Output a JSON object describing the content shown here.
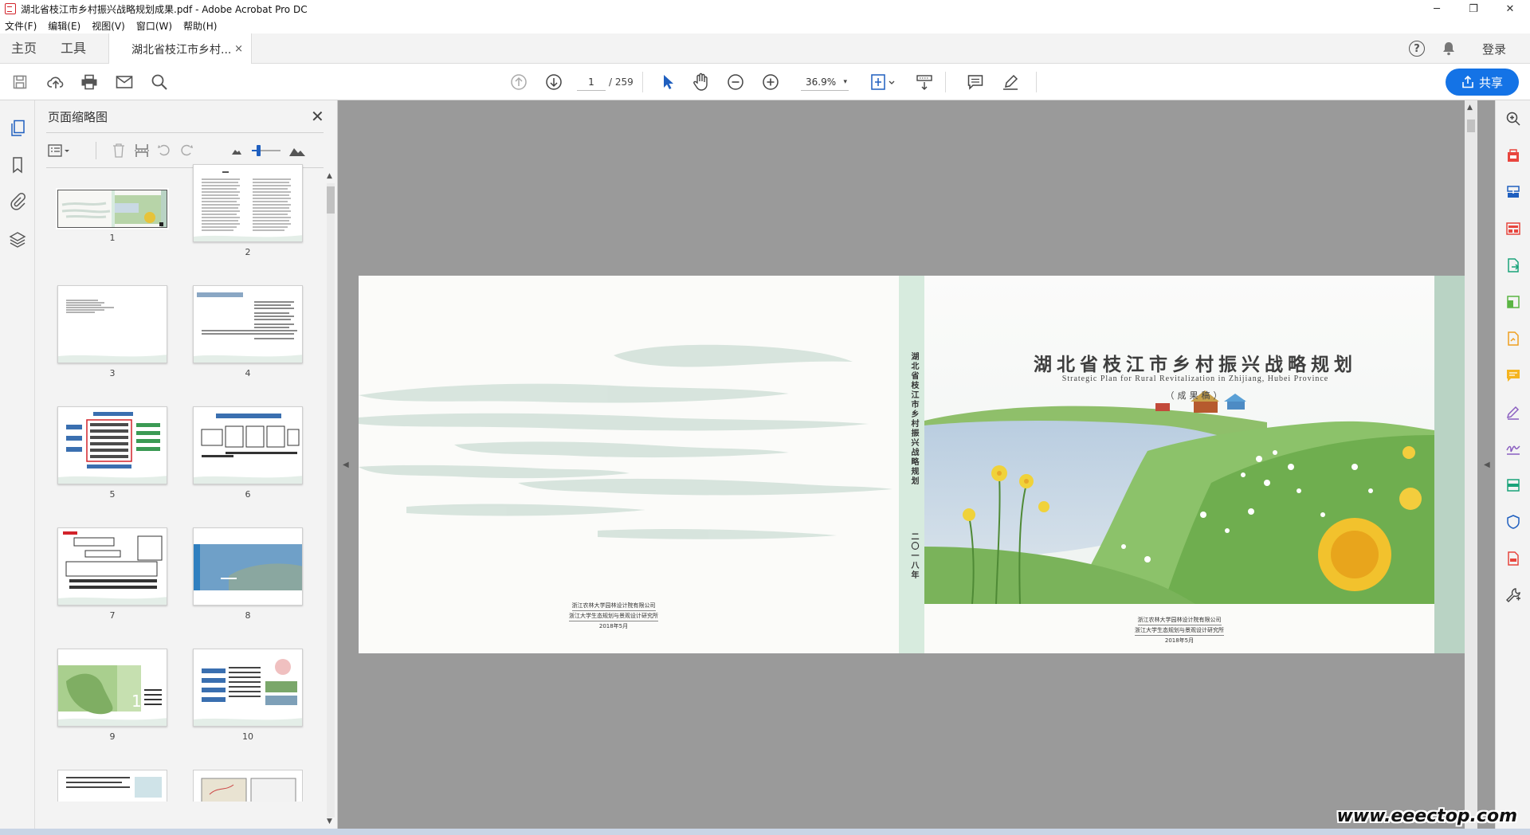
{
  "window": {
    "title": "湖北省枝江市乡村振兴战略规划成果.pdf - Adobe Acrobat Pro DC",
    "minimize": "─",
    "restore": "❐",
    "close": "✕"
  },
  "menu": [
    "文件(F)",
    "编辑(E)",
    "视图(V)",
    "窗口(W)",
    "帮助(H)"
  ],
  "tabs": {
    "home": "主页",
    "tools": "工具",
    "document": "湖北省枝江市乡村...",
    "close": "×",
    "help": "?",
    "login": "登录"
  },
  "toolbar": {
    "page_current": "1",
    "page_total": "/ 259",
    "zoom": "36.9%",
    "zoom_dropdown": "▾",
    "share": "共享"
  },
  "thumbnails": {
    "title": "页面缩略图",
    "close": "✕",
    "pages": [
      "1",
      "2",
      "3",
      "4",
      "5",
      "6",
      "7",
      "8",
      "9",
      "10"
    ]
  },
  "cover": {
    "title": "湖北省枝江市乡村振兴战略规划",
    "title_en": "Strategic Plan for Rural Revitalization in Zhijiang, Hubei Province",
    "subtitle": "（成果稿）",
    "spine_title": "湖北省枝江市乡村振兴战略规划",
    "spine_date": "二〇一八年",
    "org1": "浙江农林大学园林设计院有限公司",
    "org2": "浙江大学生态规划与景观设计研究所",
    "date": "2018年5月"
  },
  "watermark": "www.eeectop.com",
  "colors": {
    "accent": "#1473e6",
    "cover_green": "#d7ebde",
    "page_bg": "#9a9a9a"
  }
}
